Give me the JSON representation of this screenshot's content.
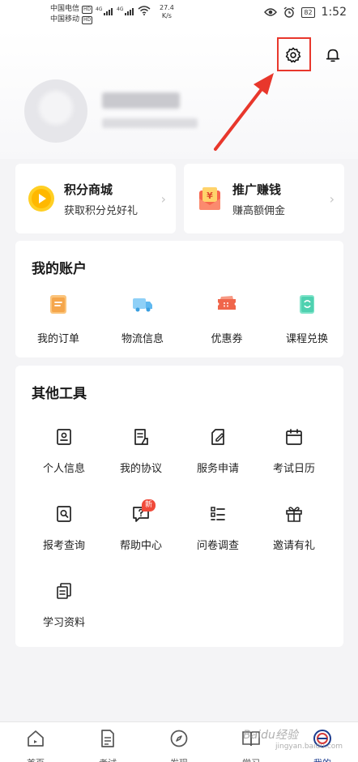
{
  "status_bar": {
    "carrier1": "中国电信",
    "carrier2": "中国移动",
    "hd": "HD",
    "net1": "4G",
    "net2": "4G",
    "speed_value": "27.4",
    "speed_unit": "K/s",
    "battery": "82",
    "time": "1:52"
  },
  "header": {
    "settings_icon": "gear-icon",
    "bell_icon": "bell-icon",
    "annotation_color": "#e8372c"
  },
  "promo": {
    "points_mall": {
      "title": "积分商城",
      "subtitle": "获取积分兑好礼"
    },
    "referral": {
      "title": "推广赚钱",
      "subtitle": "赚高额佣金"
    }
  },
  "account": {
    "title": "我的账户",
    "items": [
      {
        "label": "我的订单",
        "icon": "order-icon",
        "color": "#f5a64b"
      },
      {
        "label": "物流信息",
        "icon": "truck-icon",
        "color": "#5fb8f0"
      },
      {
        "label": "优惠券",
        "icon": "coupon-icon",
        "color": "#f0664b"
      },
      {
        "label": "课程兑换",
        "icon": "exchange-icon",
        "color": "#4fd1b0"
      }
    ]
  },
  "tools": {
    "title": "其他工具",
    "items": [
      {
        "label": "个人信息",
        "icon": "id-card-icon"
      },
      {
        "label": "我的协议",
        "icon": "document-icon"
      },
      {
        "label": "服务申请",
        "icon": "edit-icon"
      },
      {
        "label": "考试日历",
        "icon": "calendar-icon"
      },
      {
        "label": "报考查询",
        "icon": "search-doc-icon"
      },
      {
        "label": "帮助中心",
        "icon": "help-icon",
        "badge": "新"
      },
      {
        "label": "问卷调查",
        "icon": "list-icon"
      },
      {
        "label": "邀请有礼",
        "icon": "gift-icon"
      },
      {
        "label": "学习资料",
        "icon": "files-icon"
      }
    ]
  },
  "tabbar": {
    "items": [
      {
        "label": "首页",
        "icon": "home-icon"
      },
      {
        "label": "考试",
        "icon": "exam-icon"
      },
      {
        "label": "发现",
        "icon": "compass-icon"
      },
      {
        "label": "学习",
        "icon": "book-icon"
      },
      {
        "label": "我的",
        "icon": "profile-icon",
        "active": true
      }
    ]
  },
  "watermark": {
    "main": "Baidu经验",
    "sub": "jingyan.baidu.com"
  }
}
